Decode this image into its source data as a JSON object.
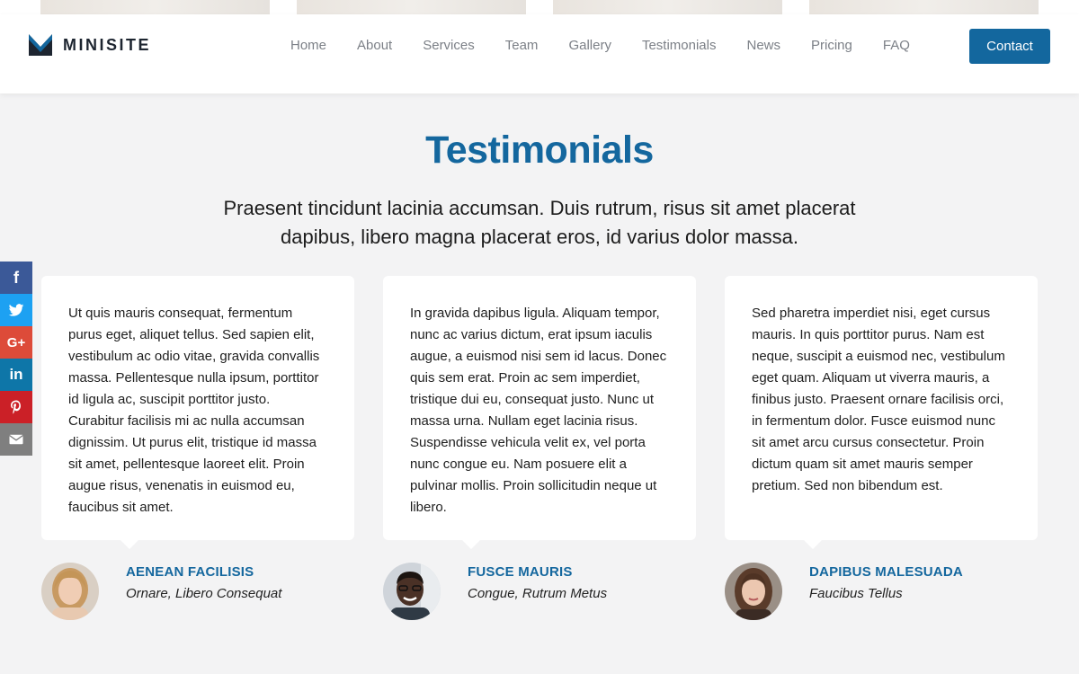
{
  "brand": {
    "name": "MINISITE",
    "accent": "#14679e"
  },
  "nav": {
    "items": [
      "Home",
      "About",
      "Services",
      "Team",
      "Gallery",
      "Testimonials",
      "News",
      "Pricing",
      "FAQ"
    ],
    "contact_label": "Contact"
  },
  "section": {
    "title": "Testimonials",
    "subtitle": "Praesent tincidunt lacinia accumsan. Duis rutrum, risus sit amet placerat dapibus, libero magna placerat eros, id varius dolor massa."
  },
  "social": [
    {
      "icon": "facebook-icon",
      "glyph": "f",
      "color": "#3b5998"
    },
    {
      "icon": "twitter-icon",
      "glyph": "🐦",
      "color": "#1da1f2"
    },
    {
      "icon": "google-plus-icon",
      "glyph": "G+",
      "color": "#dd4b39"
    },
    {
      "icon": "linkedin-icon",
      "glyph": "in",
      "color": "#0e76a8"
    },
    {
      "icon": "pinterest-icon",
      "glyph": "P",
      "color": "#cb2027"
    },
    {
      "icon": "email-icon",
      "glyph": "✉",
      "color": "#7f7f7f"
    }
  ],
  "testimonials": [
    {
      "text": "Ut quis mauris consequat, fermentum purus eget, aliquet tellus. Sed sapien elit, vestibulum ac odio vitae, gravida convallis massa. Pellentesque nulla ipsum, porttitor id ligula ac, suscipit porttitor justo. Curabitur facilisis mi ac nulla accumsan dignissim. Ut purus elit, tristique id massa sit amet, pellentesque laoreet elit. Proin augue risus, venenatis in euismod eu, faucibus sit amet.",
      "name": "AENEAN FACILISIS",
      "role": "Ornare, Libero Consequat"
    },
    {
      "text": "In gravida dapibus ligula. Aliquam tempor, nunc ac varius dictum, erat ipsum iaculis augue, a euismod nisi sem id lacus. Donec quis sem erat. Proin ac sem imperdiet, tristique dui eu, consequat justo. Nunc ut massa urna. Nullam eget lacinia risus. Suspendisse vehicula velit ex, vel porta nunc congue eu. Nam posuere elit a pulvinar mollis. Proin sollicitudin neque ut libero.",
      "name": "FUSCE MAURIS",
      "role": "Congue, Rutrum Metus"
    },
    {
      "text": "Sed pharetra imperdiet nisi, eget cursus mauris. In quis porttitor purus. Nam est neque, suscipit a euismod nec, vestibulum eget quam. Aliquam ut viverra mauris, a finibus justo. Praesent ornare facilisis orci, in fermentum dolor. Fusce euismod nunc sit amet arcu cursus consectetur. Proin dictum quam sit amet mauris semper pretium. Sed non bibendum est.",
      "name": "DAPIBUS MALESUADA",
      "role": "Faucibus Tellus"
    }
  ]
}
